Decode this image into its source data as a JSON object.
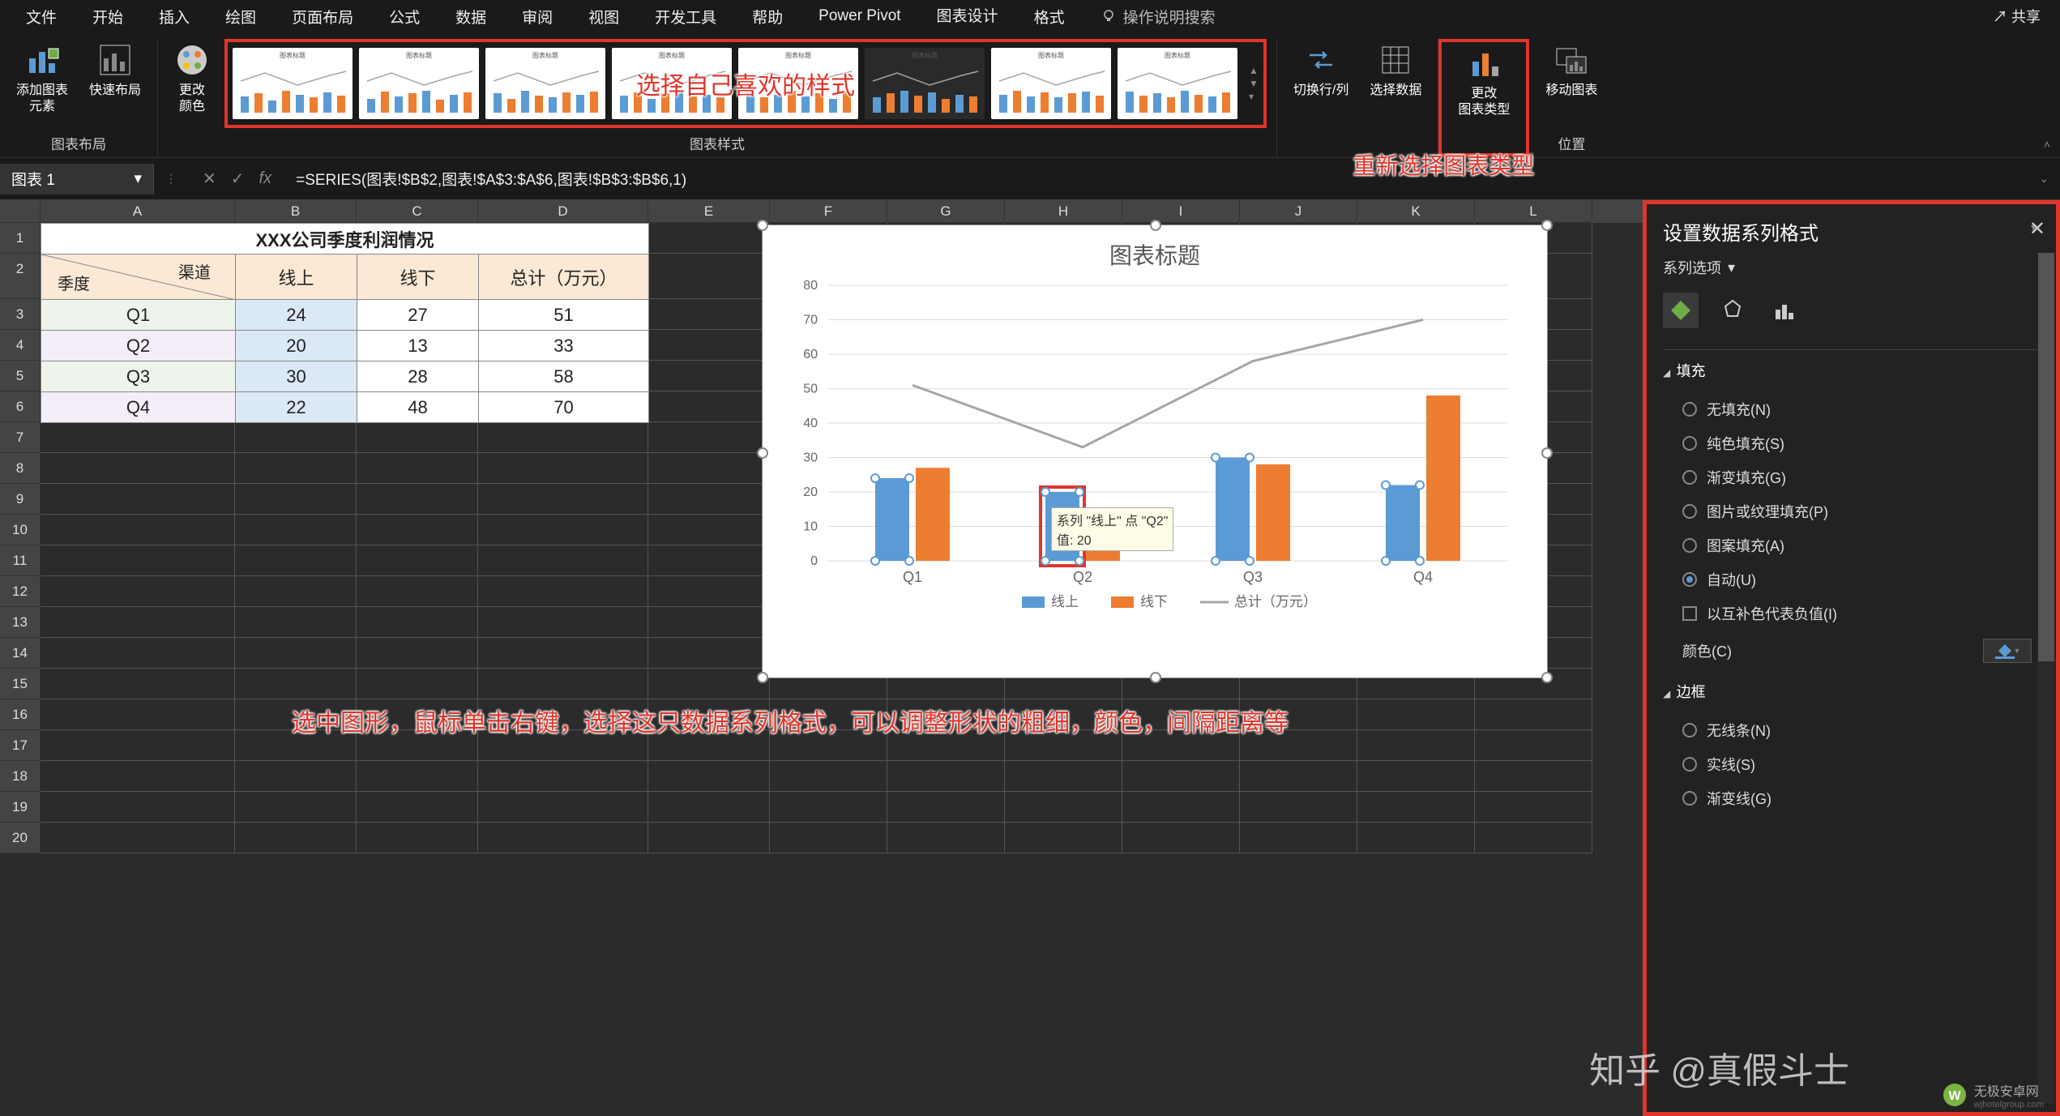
{
  "menu": {
    "items": [
      "文件",
      "开始",
      "插入",
      "绘图",
      "页面布局",
      "公式",
      "数据",
      "审阅",
      "视图",
      "开发工具",
      "帮助",
      "Power Pivot",
      "图表设计",
      "格式"
    ],
    "active_index": 12,
    "bulb_hint": "操作说明搜索",
    "share": "共享"
  },
  "ribbon": {
    "layout": {
      "label": "图表布局",
      "add_element": "添加图表\n元素",
      "quick_layout": "快速布局"
    },
    "styles": {
      "label": "图表样式",
      "change_colors": "更改\n颜色"
    },
    "data": {
      "switch": "切换行/列",
      "select": "选择数据"
    },
    "type": {
      "label": "",
      "change_type": "更改\n图表类型"
    },
    "location": {
      "label": "位置",
      "move": "移动图表"
    }
  },
  "annotations": {
    "styles_overlay": "选择自己喜欢的样式",
    "type_bottom": "重新选择图表类型",
    "sheet_bottom": "选中图形，鼠标单击右键，选择这只数据系列格式，可以调整形状的粗细，颜色，间隔距离等"
  },
  "formulabar": {
    "namebox": "图表 1",
    "formula": "=SERIES(图表!$B$2,图表!$A$3:$A$6,图表!$B$3:$B$6,1)"
  },
  "columns": [
    "A",
    "B",
    "C",
    "D",
    "E",
    "F",
    "G",
    "H",
    "I",
    "J",
    "K",
    "L"
  ],
  "table": {
    "title": "XXX公司季度利润情况",
    "diag_top": "渠道",
    "diag_bottom": "季度",
    "headers": [
      "线上",
      "线下",
      "总计（万元）"
    ],
    "rows": [
      {
        "q": "Q1",
        "online": 24,
        "offline": 27,
        "total": 51
      },
      {
        "q": "Q2",
        "online": 20,
        "offline": 13,
        "total": 33
      },
      {
        "q": "Q3",
        "online": 30,
        "offline": 28,
        "total": 58
      },
      {
        "q": "Q4",
        "online": 22,
        "offline": 48,
        "total": 70
      }
    ]
  },
  "chart_data": {
    "type": "bar",
    "title": "图表标题",
    "categories": [
      "Q1",
      "Q2",
      "Q3",
      "Q4"
    ],
    "series": [
      {
        "name": "线上",
        "type": "bar",
        "values": [
          24,
          20,
          30,
          22
        ],
        "color": "#5b9bd5"
      },
      {
        "name": "线下",
        "type": "bar",
        "values": [
          27,
          13,
          28,
          48
        ],
        "color": "#ed7d31"
      },
      {
        "name": "总计（万元）",
        "type": "line",
        "values": [
          51,
          33,
          58,
          70
        ],
        "color": "#a6a6a6"
      }
    ],
    "ylim": [
      0,
      80
    ],
    "yticks": [
      0,
      10,
      20,
      30,
      40,
      50,
      60,
      70,
      80
    ],
    "tooltip": "系列 \"线上\" 点 \"Q2\"\n值: 20",
    "selected": {
      "series": 0,
      "point": 1
    }
  },
  "pane": {
    "title": "设置数据系列格式",
    "dropdown": "系列选项",
    "sections": {
      "fill": {
        "title": "填充",
        "opts": [
          "无填充(N)",
          "纯色填充(S)",
          "渐变填充(G)",
          "图片或纹理填充(P)",
          "图案填充(A)",
          "自动(U)"
        ],
        "checked": 5,
        "neg_invert": "以互补色代表负值(I)",
        "color_label": "颜色(C)"
      },
      "border": {
        "title": "边框",
        "opts": [
          "无线条(N)",
          "实线(S)",
          "渐变线(G)"
        ]
      }
    }
  },
  "brand": {
    "overlay": "知乎 @真假斗士",
    "watermark": "无极安卓网",
    "watermark_url": "wjhotelgroup.com"
  }
}
